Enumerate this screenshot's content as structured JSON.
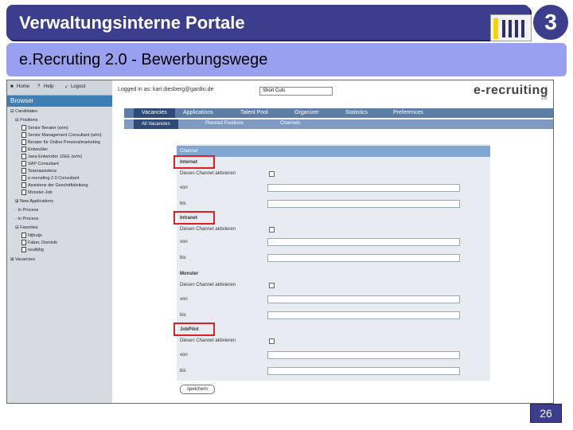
{
  "slide": {
    "title": "Verwaltungsinterne Portale",
    "logo_text": "3",
    "subtitle": "e.Recruting 2.0  - Bewerbungswege",
    "page_number": "26"
  },
  "app": {
    "toolbar": {
      "items": [
        "Home",
        "Help",
        "Logout"
      ]
    },
    "browser_label": "Browser",
    "tree": [
      "Candidates",
      "Positions",
      "Senior Berater (w/m)",
      "Senior Management Consultant (w/m)",
      "Berater für Online Personalmarketing",
      "Entwickler",
      "Java Entwickler J2EE (w/m)",
      "SAP Consultant",
      "Teamassistenz",
      "e-recruiting 2.0 Consultant",
      "Assistenz der Geschäftsleitung",
      "Monster-Job",
      "New Applications",
      "In Process",
      "In Process",
      "Favorites",
      "Nijhuijs",
      "Faber, Dominik",
      "osuliijhg",
      "Vacancies"
    ],
    "logged_in": "Logged in as: kari.diesberg@gardio.de",
    "shortcuts": "Short Cuts",
    "brand": "e-recruiting",
    "brand_version": "2.0",
    "main_tabs": [
      "Vacancies",
      "Applications",
      "Talent Pool",
      "Organizer",
      "Statistics",
      "Preferences"
    ],
    "active_main_tab": "Vacancies",
    "sub_tabs": [
      "All Vacancies",
      "Planned Positions",
      "Channels"
    ],
    "active_sub_tab": "All Vacancies",
    "form": {
      "header": "Channel",
      "channels": [
        {
          "name": "Internet",
          "activate_label": "Diesen Channel aktivieren",
          "von_label": "von",
          "bis_label": "bis",
          "highlighted": true
        },
        {
          "name": "Intranet",
          "activate_label": "Diesen Channel aktivieren",
          "von_label": "von",
          "bis_label": "bis",
          "highlighted": true
        },
        {
          "name": "Monster",
          "activate_label": "Diesen Channel aktivieren",
          "von_label": "von",
          "bis_label": "bis",
          "highlighted": false
        },
        {
          "name": "JobPilot",
          "activate_label": "Diesen Channel aktivieren",
          "von_label": "von",
          "bis_label": "bis",
          "highlighted": true
        }
      ],
      "save_button": "speichern"
    }
  },
  "colors": {
    "title_bg": "#3a3e8c",
    "subtitle_bg": "#9aa0f0",
    "highlight": "#e02020",
    "nav_bg": "#5c7ea6"
  }
}
